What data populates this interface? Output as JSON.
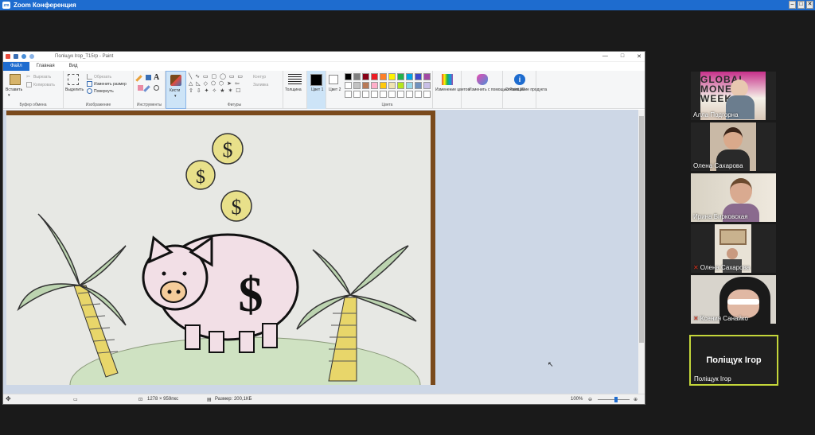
{
  "zoom": {
    "title": "Zoom Конференция",
    "logo": "zm"
  },
  "paint": {
    "title": "Поліщук Ігор_Т15гр - Paint",
    "tabs": [
      "Файл",
      "Главная",
      "Вид"
    ],
    "clipboard": {
      "paste": "Вставить",
      "cut": "Вырезать",
      "copy": "Копировать",
      "group": "Буфер обмена"
    },
    "image": {
      "select": "Выделить",
      "crop": "Обрезать",
      "resize": "Изменить размер",
      "rotate": "Повернуть",
      "group": "Изображение"
    },
    "tools": {
      "group": "Инструменты"
    },
    "brushes": {
      "label": "Кисти"
    },
    "shapes": {
      "outline": "Контур",
      "fill": "Заливка",
      "group": "Фигуры"
    },
    "size_label": "Толщина",
    "color1": "Цвет 1",
    "color2": "Цвет 2",
    "colors_group": "Цвета",
    "edit_colors": "Изменение цветов",
    "paint3d": "Изменить с помощью Paint 3D",
    "product_alert": "Оповещение продукта",
    "status": {
      "dimensions": "1278 × 959пкс",
      "size": "Размер: 200,1КБ",
      "zoom": "100%"
    }
  },
  "palette_colors": [
    "#000000",
    "#7f7f7f",
    "#880015",
    "#ed1c24",
    "#ff7f27",
    "#fff200",
    "#22b14c",
    "#00a2e8",
    "#3f48cc",
    "#a349a4",
    "#ffffff",
    "#c3c3c3",
    "#b97a57",
    "#ffaec9",
    "#ffc90e",
    "#efe4b0",
    "#b5e61d",
    "#99d9ea",
    "#7092be",
    "#c8bfe7"
  ],
  "participants": [
    {
      "name": "Алла Подгорна",
      "muted": false
    },
    {
      "name": "Олена Сахарова",
      "muted": false
    },
    {
      "name": "Ирина Бирковская",
      "muted": false
    },
    {
      "name": "Олена Сахарова",
      "muted": true
    },
    {
      "name": "Ксения Санайко",
      "muted": true
    }
  ],
  "active_speaker": {
    "display_name": "Поліщук Ігор",
    "label": "Поліщук Ігор"
  },
  "colors": {
    "zoom_blue": "#1e6ccf",
    "active_border": "#c4d63a",
    "mute_red": "#e0341e"
  }
}
